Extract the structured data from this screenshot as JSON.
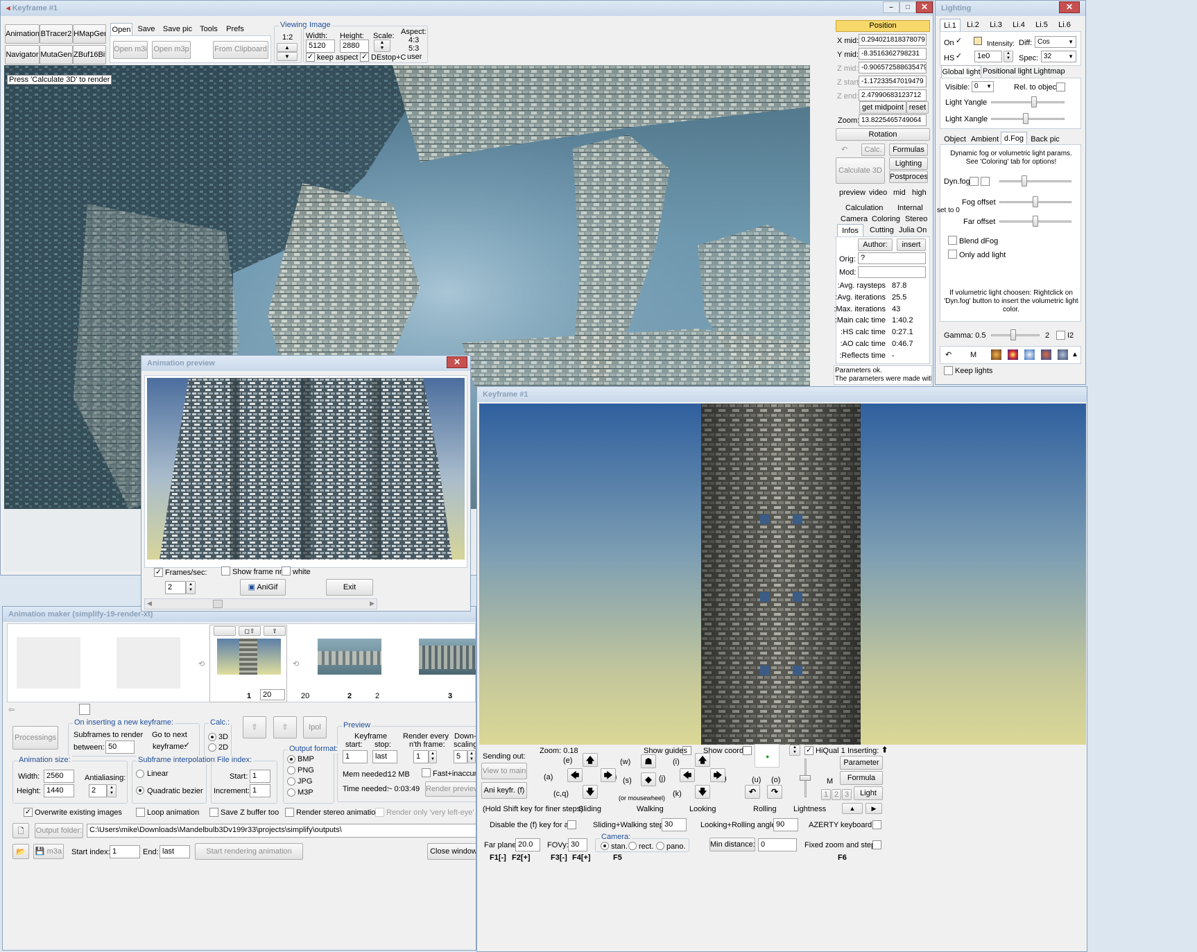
{
  "main": {
    "title": "Keyframe #1",
    "toolbar_left": [
      "Animations",
      "BTracer2",
      "HMapGen",
      "Navigator",
      "MutaGen",
      "ZBuf16Bit"
    ],
    "menu_tabs": [
      "Open",
      "Save",
      "Save pic",
      "Tools",
      "Prefs"
    ],
    "open_m3i": "Open m3i",
    "open_m3p": "Open m3p",
    "from_clipboard": "From Clipboard",
    "viewing_label": "Viewing",
    "viewing_ratio": "1:2",
    "image_label": "Image",
    "width_label": "Width:",
    "width_value": "5120",
    "height_label": "Height:",
    "height_value": "2880",
    "scale_label": "Scale:",
    "aspect_label": "Aspect:",
    "aspect_opts": [
      "4:3",
      "5:3",
      "user"
    ],
    "keep_aspect": "keep aspect",
    "destop": "DEstop+C",
    "status_hint": "Press 'Calculate 3D' to render"
  },
  "position": {
    "header": "Position",
    "rows": [
      {
        "label": "X mid:",
        "value": "0.294021818378079"
      },
      {
        "label": "Y mid:",
        "value": "-8.35163627982​31"
      },
      {
        "label": "Z mid:",
        "value": "-0.906572588635479"
      },
      {
        "label": "Z start:",
        "value": "-1.17233547019479"
      },
      {
        "label": "Z end:",
        "value": "2.47990683123712"
      }
    ],
    "get_midpoint": "get midpoint",
    "reset": "reset",
    "zoom_label": "Zoom:",
    "zoom_value": "13.8225465749064",
    "rotation": "Rotation",
    "calc": "Calc.",
    "formulas": "Formulas",
    "lighting": "Lighting",
    "postprocess": "Postprocess",
    "calculate_3d": "Calculate 3D",
    "quality": [
      "preview",
      "video",
      "mid",
      "high"
    ],
    "tabs_row1": [
      "Calculation",
      "Internal"
    ],
    "tabs_row2": [
      "Camera",
      "Coloring",
      "Stereo"
    ],
    "tabs_row3": [
      "Infos",
      "Cutting",
      "Julia On"
    ],
    "author": "Author:",
    "insert": "insert",
    "orig_label": "Orig:",
    "orig_value": "?",
    "mod_label": "Mod:",
    "stats": [
      {
        "k": "Avg. raysteps:",
        "v": "87.8"
      },
      {
        "k": "Avg. iterations:",
        "v": "25.5"
      },
      {
        "k": "Max. iterations:",
        "v": "43"
      },
      {
        "k": "Main calc time:",
        "v": "1:40.2"
      },
      {
        "k": "HS calc time:",
        "v": "0:27.1"
      },
      {
        "k": "AO calc time:",
        "v": "0:46.7"
      },
      {
        "k": "Reflects time:",
        "v": "-"
      }
    ],
    "msg1": "Parameters ok.",
    "msg2": "The parameters were made with"
  },
  "lighting": {
    "title": "Lighting",
    "light_tabs": [
      "Li.1",
      "Li.2",
      "Li.3",
      "Li.4",
      "Li.5",
      "Li.6"
    ],
    "on": "On",
    "hs": "HS",
    "intensity": "Intensity:",
    "diff": "Diff:",
    "diff_value": "Cos",
    "spec": "Spec:",
    "spec_value": "32",
    "hs_value": "1e0",
    "sub_tabs": [
      "Global light",
      "Positional light",
      "Lightmap"
    ],
    "visible": "Visible:",
    "visible_value": "0",
    "rel": "Rel. to object:",
    "yangle": "Light Yangle",
    "xangle": "Light Xangle",
    "obj_tabs": [
      "Object",
      "Ambient",
      "d.Fog",
      "Back pic"
    ],
    "dyn_text": "Dynamic fog or volumetric light params. See 'Coloring' tab for options!",
    "dynfog": "Dyn.fog",
    "fog_offset": "Fog offset",
    "set_to_0": "set to 0",
    "far_offset": "Far offset",
    "blend": "Blend dFog",
    "only_add": "Only add light",
    "vol_text": "If volumetric light choosen: Rightclick on 'Dyn.fog' button to insert the volumetric light color.",
    "gamma": "Gamma: 0.5",
    "gamma_2": "2",
    "i2": "I2",
    "m": "M",
    "keep_lights": "Keep lights"
  },
  "preview": {
    "title": "Animation preview",
    "frames_sec": "Frames/sec:",
    "show_frame": "Show frame nr",
    "white": "white",
    "fps_value": "2",
    "anigif": "AniGif",
    "exit": "Exit"
  },
  "maker": {
    "title": "Animation maker   (simplify-19-render-xt)",
    "frames": [
      {
        "num": "1",
        "sub": "20"
      },
      {
        "num": "20"
      },
      {
        "num": "2"
      },
      {
        "num": "2"
      },
      {
        "num": "3"
      }
    ],
    "processings": "Processings",
    "on_inserting": "On inserting a new keyframe:",
    "subframes": "Subframes to render",
    "between": "between:",
    "between_value": "50",
    "go_next": "Go to next",
    "keyframe": "keyframe:",
    "calc": "Calc.:",
    "c3d": "3D",
    "c2d": "2D",
    "ipol": "Ipol",
    "preview_grp": "Preview",
    "kf_start": "Keyframe",
    "start": "start:",
    "stop": "stop:",
    "start_value": "1",
    "stop_value": "last",
    "render_every": "Render every",
    "nth": "n'th frame:",
    "nth_value": "1",
    "down": "Down-",
    "scaling": "scaling:",
    "down_value": "5",
    "mem": "Mem needed:",
    "mem_value": "12 MB",
    "time_needed": "Time needed:",
    "time_value": "~ 0:03:49",
    "fast": "Fast+inaccurat",
    "render_preview": "Render preview",
    "ani_size": "Animation size:",
    "w_label": "Width:",
    "w_value": "2560",
    "h_label": "Height:",
    "h_value": "1440",
    "aa": "Antialiasing:",
    "aa_value": "2",
    "sub_interp": "Subframe interpolation:",
    "linear": "Linear",
    "quad": "Quadratic bezier",
    "file_index": "File index:",
    "fi_start": "Start:",
    "fi_start_value": "1",
    "increment": "Increment:",
    "inc_value": "1",
    "out_format": "Output format:",
    "formats": [
      "BMP",
      "PNG",
      "JPG",
      "M3P"
    ],
    "overwrite": "Overwrite existing images",
    "loop": "Loop animation",
    "savez": "Save Z buffer too",
    "stereo": "Render stereo animation",
    "left_eye": "Render only 'very left-eye' ima",
    "output_folder": "Output folder:",
    "path": "C:\\Users\\mike\\Downloads\\Mandelbulb3Dv199r33\\projects\\simplify\\outputs\\",
    "m3a": "m3a",
    "start_index": "Start index:",
    "si_value": "1",
    "end": "End:",
    "end_value": "last",
    "start_rendering": "Start rendering animation",
    "close": "Close window"
  },
  "kf": {
    "title": "Keyframe #1",
    "sending": "Sending out:",
    "view_main": "View to main",
    "ani_keyfr": "Ani keyfr. (f)",
    "zoom": "Zoom: 0.18",
    "show_guides": "Show guides",
    "show_coords": "Show coords",
    "hiqual": "HiQual 1",
    "inserting": "Inserting:",
    "parameter": "Parameter",
    "formula": "Formula",
    "light": "Light",
    "m": "M",
    "lightness": "Lightness",
    "keys": {
      "e": "(e)",
      "a": "(a)",
      "d": "(d)",
      "cq": "(c,q)",
      "w": "(w)",
      "s": "(s)",
      "mw": "(or mousewheel)",
      "i": "(i)",
      "j": "(j)",
      "l": "(l)",
      "k": "(k)",
      "u": "(u)",
      "o": "(o)"
    },
    "sliding": "Sliding",
    "walking": "Walking",
    "looking": "Looking",
    "rolling": "Rolling",
    "hold_shift": "(Hold Shift key for finer steps)",
    "disable": "Disable the (f) key for ani",
    "sw_step": "Sliding+Walking step:",
    "sw_value": "30",
    "lr_angle": "Looking+Rolling angle:",
    "lr_value": "90",
    "azerty": "AZERTY keyboard",
    "far_plane": "Far plane:",
    "far_value": "20.0",
    "fovy": "FOVy:",
    "fovy_value": "30",
    "camera": "Camera:",
    "stan": "stan.",
    "rect": "rect.",
    "pano": "pano.",
    "min_dist": "Min distance:",
    "min_value": "0",
    "fixed": "Fixed zoom and steps",
    "fkeys": [
      "F1[-]",
      "F2[+]",
      "F3[-]",
      "F4[+]",
      "F5",
      "F6"
    ],
    "n123": [
      "1",
      "2",
      "3"
    ]
  },
  "colors": {
    "accent": "#1e4d99",
    "title_bg": "#c9d8ea",
    "close": "#c75050",
    "pos_header": "#f7d86a"
  }
}
